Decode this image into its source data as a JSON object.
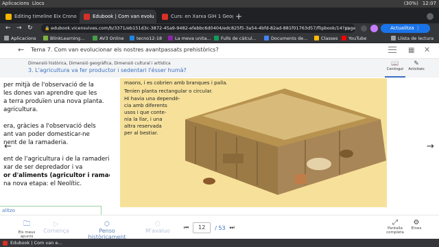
{
  "system": {
    "apps": "Aplicacions",
    "places": "Llocs",
    "battery": "(30%)",
    "clock": "12:07"
  },
  "tabs": [
    {
      "title": "Editing timeline Eix Crono",
      "color": "#f4b400"
    },
    {
      "title": "Edubook | Com van evolu",
      "color": "#d93025",
      "active": true
    },
    {
      "title": "Curs: en Xarxa GiH 1 Geog",
      "color": "#d93025"
    }
  ],
  "newtab": "+",
  "url": "edubook.vicensvives.com/b/3371/eb151d3c-3872-45a9-9482-efebbc6d0404/edc825f5-3a54-4bfd-82ad-881f01763d57/flipbook/14?page=1&sh...",
  "update_label": "Actualitza",
  "bookmarks": [
    {
      "label": "Aplicacions",
      "color": "#9aa0a6"
    },
    {
      "label": "BlinkLearning...",
      "color": "#7cb342"
    },
    {
      "label": "AV3 Online",
      "color": "#43a047"
    },
    {
      "label": "tecno12-18",
      "color": "#1e88e5"
    },
    {
      "label": "La meva unita...",
      "color": "#8e24aa"
    },
    {
      "label": "Fulls de càlcul...",
      "color": "#0f9d58"
    },
    {
      "label": "Documents de...",
      "color": "#4285f4"
    },
    {
      "label": "Classes",
      "color": "#fbbc04"
    },
    {
      "label": "YouTube",
      "color": "#ff0000"
    }
  ],
  "reading_list": "Llista de lectura",
  "page": {
    "topic": "Tema 7. Com van evolucionar els nostres avantpassats prehistòrics?",
    "dimensions": "Dimensió històrica, Dimensió geogràfica, Dimensió cultural i artística",
    "lesson": "3. L'agricultura va fer productor i sedentari l'ésser humà?",
    "tools": [
      {
        "label": "Contingut"
      },
      {
        "label": "Activitats"
      }
    ],
    "text_lines": [
      "per mitjà de l'observació de la",
      "les dones van aprendre que les",
      "a terra produïen una nova planta.",
      "agricultura.",
      "",
      "era, gràcies a l'observació dels",
      "ant van poder domesticar-ne",
      "nent de la ramaderia.",
      "",
      "ent de l'agricultura i de la ramaderia,",
      "xar de ser depredador i va",
      "or d'aliments (agricultor i ramader).",
      "na nova etapa: el Neolític."
    ],
    "box_text": "alitzo",
    "illustration_text": [
      "maons, i es cobrien amb branques i palla.",
      "Tenien planta rectangular o circular.",
      "Hi havia una dependè-",
      "cia amb diferents",
      "usos i que conte-",
      "nia la llar, i una",
      "altra reservada",
      "per al bestiar."
    ]
  },
  "bottom": {
    "notes": "Els meus apunts",
    "steps": [
      "Comença",
      "Penso històricament",
      "M'avaluo"
    ],
    "current_page": "12",
    "total_pages": "/ 53",
    "fullscreen": "Pantalla completa",
    "settings": "Eines"
  },
  "download": {
    "file": "Edubook | Com van e..."
  }
}
